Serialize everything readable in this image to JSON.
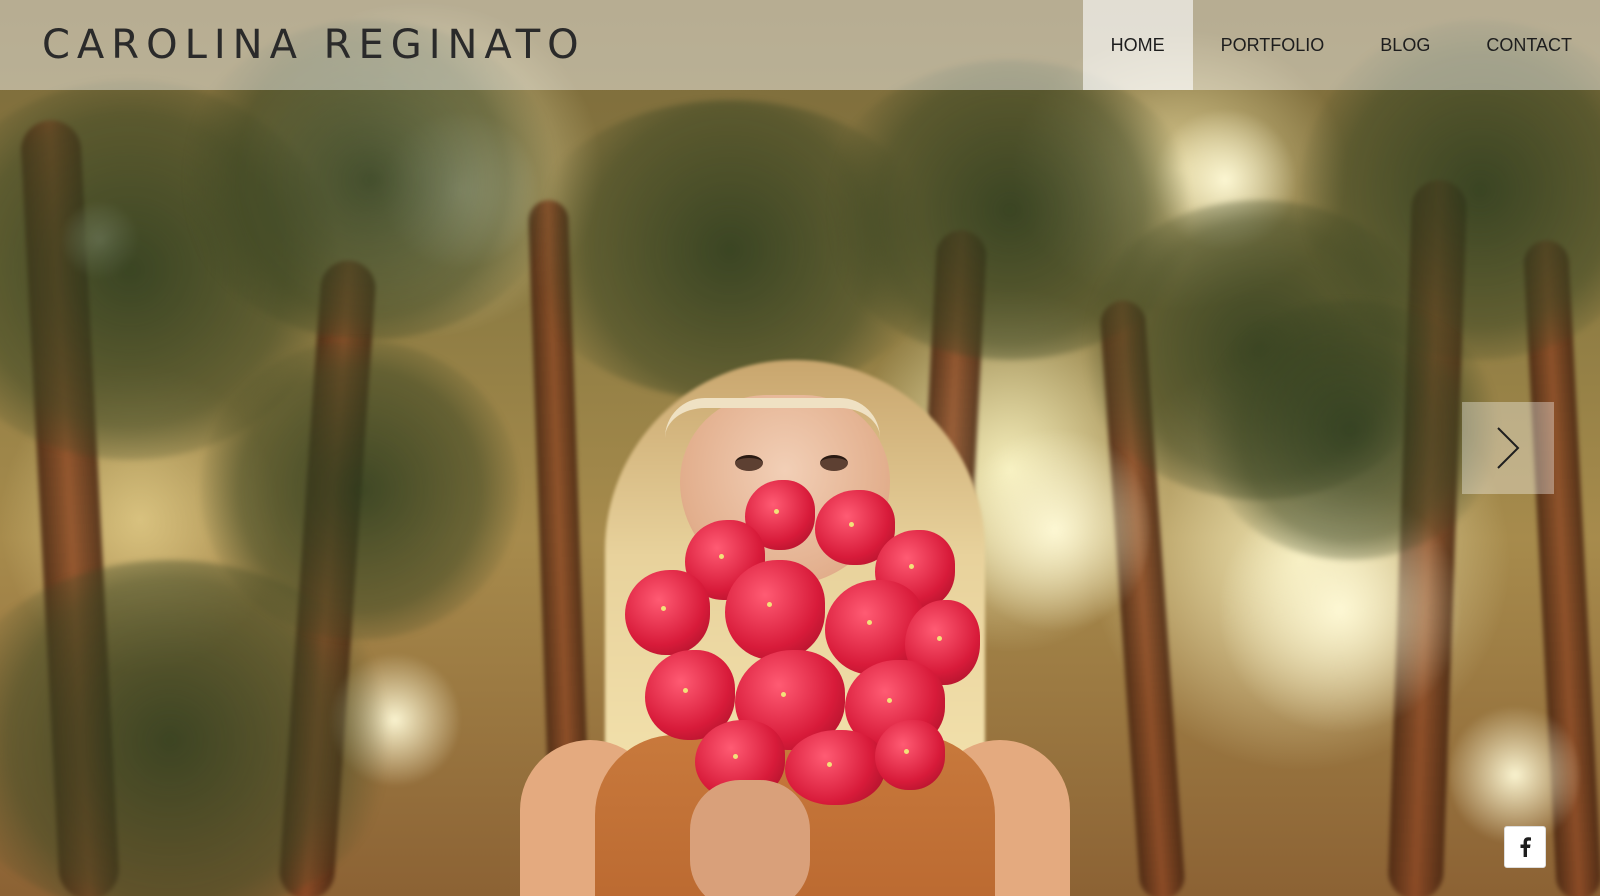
{
  "header": {
    "site_title": "CAROLINA REGINATO",
    "nav": [
      {
        "label": "HOME",
        "active": true
      },
      {
        "label": "PORTFOLIO",
        "active": false
      },
      {
        "label": "BLOG",
        "active": false
      },
      {
        "label": "CONTACT",
        "active": false
      }
    ]
  },
  "slideshow": {
    "next_icon": "chevron-right-icon"
  },
  "social": {
    "facebook_icon": "facebook-icon"
  },
  "colors": {
    "header_overlay": "#ffffff",
    "text": "#1d1d1d",
    "accent_flowers": "#d81b3a"
  }
}
